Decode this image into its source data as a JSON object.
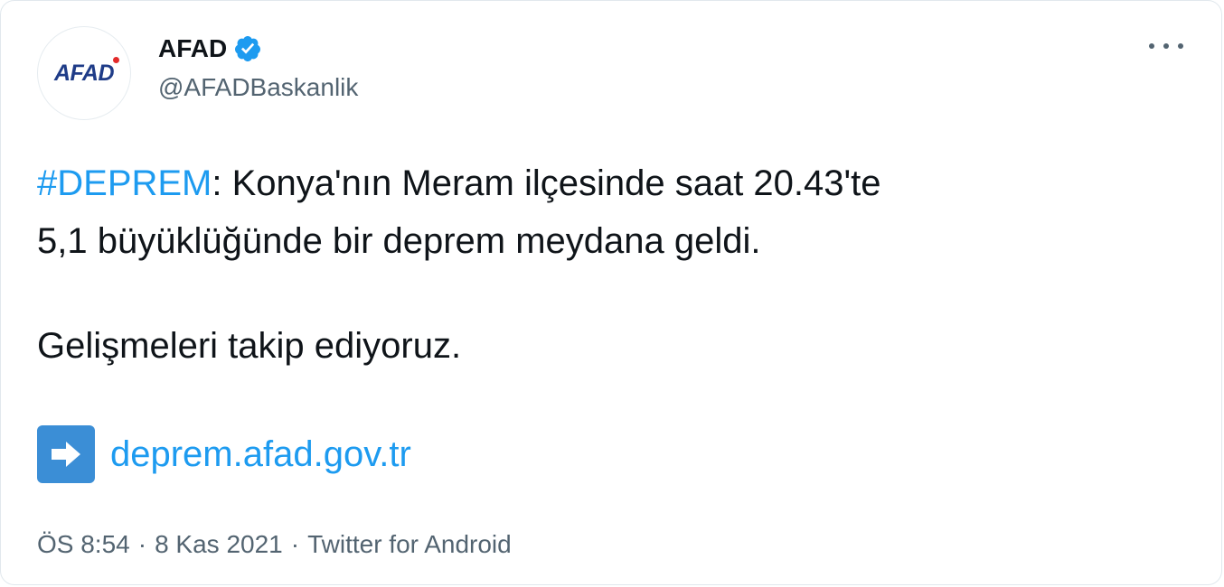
{
  "author": {
    "avatar_text": "AFAD",
    "display_name": "AFAD",
    "handle": "@AFADBaskanlik",
    "verified": true
  },
  "tweet": {
    "hashtag": "#DEPREM",
    "line1_rest": ": Konya'nın Meram ilçesinde saat 20.43'te",
    "line2": "5,1 büyüklüğünde bir deprem meydana geldi.",
    "line3": "Gelişmeleri takip ediyoruz.",
    "link_icon": "right-arrow-emoji",
    "link": "deprem.afad.gov.tr"
  },
  "meta": {
    "time": "ÖS 8:54",
    "separator": "·",
    "date": "8 Kas 2021",
    "source": "Twitter for Android"
  },
  "colors": {
    "accent": "#1d9bf0",
    "text": "#0f1419",
    "secondary": "#536471",
    "brand": "#1f3c88"
  }
}
